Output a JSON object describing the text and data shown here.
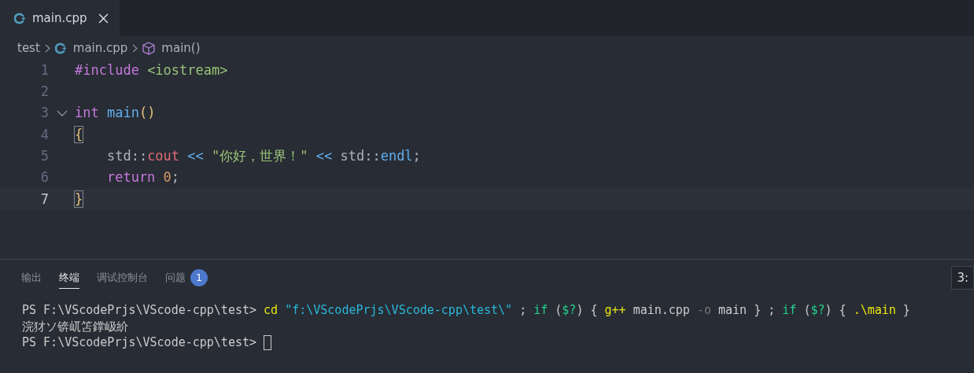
{
  "tabs": [
    {
      "label": "main.cpp",
      "selected": true
    }
  ],
  "breadcrumb": [
    {
      "kind": "folder",
      "label": "test"
    },
    {
      "kind": "file",
      "label": "main.cpp"
    },
    {
      "kind": "symbol",
      "label": "main()"
    }
  ],
  "code_lines": [
    {
      "number": "1",
      "current": false,
      "foldable": false,
      "tokens": [
        {
          "kind": "keyword",
          "text": "#include"
        },
        {
          "kind": "string",
          "text": " <iostream>"
        }
      ]
    },
    {
      "number": "2",
      "current": false,
      "foldable": false
    },
    {
      "number": "3",
      "current": false,
      "foldable": true,
      "tokens": [
        {
          "kind": "keyword",
          "text": "int"
        },
        {
          "kind": "function",
          "text": " main"
        },
        {
          "kind": "bracket",
          "text": "()"
        }
      ]
    },
    {
      "number": "4",
      "current": false,
      "foldable": false,
      "tokens": [
        {
          "kind": "bracket_matched",
          "text": "{"
        }
      ]
    },
    {
      "number": "5",
      "current": false,
      "foldable": false,
      "tokens": [
        {
          "kind": "plain",
          "text": "    std::"
        },
        {
          "kind": "member",
          "text": "cout"
        },
        {
          "kind": "operator",
          "text": " <<"
        },
        {
          "kind": "string",
          "text": " \"你好，世界！\""
        },
        {
          "kind": "operator",
          "text": " <<"
        },
        {
          "kind": "plain",
          "text": " std::"
        },
        {
          "kind": "function",
          "text": "endl"
        },
        {
          "kind": "plain",
          "text": ";"
        }
      ]
    },
    {
      "number": "6",
      "current": false,
      "foldable": false,
      "tokens": [
        {
          "kind": "keyword",
          "text": "    return"
        },
        {
          "kind": "number",
          "text": " 0"
        },
        {
          "kind": "plain",
          "text": ";"
        }
      ]
    },
    {
      "number": "7",
      "current": true,
      "foldable": false,
      "tokens": [
        {
          "kind": "bracket_matched",
          "text": "}"
        }
      ]
    }
  ],
  "panel_tabs": [
    {
      "label": "输出",
      "selected": false
    },
    {
      "label": "终端",
      "selected": true
    },
    {
      "label": "调试控制台",
      "selected": false
    },
    {
      "label": "问题",
      "selected": false,
      "badge": "1"
    }
  ],
  "terminal_selector": "3:",
  "terminal_lines": [
    {
      "tokens": [
        {
          "kind": "plain",
          "text": "PS F:\\VScodePrjs\\VScode-cpp\\test> "
        },
        {
          "kind": "command",
          "text": "cd"
        },
        {
          "kind": "string",
          "text": " \"f:\\VScodePrjs\\VScode-cpp\\test\\\""
        },
        {
          "kind": "plain",
          "text": " ; "
        },
        {
          "kind": "keyword",
          "text": "if"
        },
        {
          "kind": "plain",
          "text": " ("
        },
        {
          "kind": "keyword",
          "text": "$?"
        },
        {
          "kind": "plain",
          "text": ") { "
        },
        {
          "kind": "command",
          "text": "g++"
        },
        {
          "kind": "plain",
          "text": " main.cpp "
        },
        {
          "kind": "parameter",
          "text": "-o"
        },
        {
          "kind": "plain",
          "text": " main } ; "
        },
        {
          "kind": "keyword",
          "text": "if"
        },
        {
          "kind": "plain",
          "text": " ("
        },
        {
          "kind": "keyword",
          "text": "$?"
        },
        {
          "kind": "plain",
          "text": ") { "
        },
        {
          "kind": "command",
          "text": ".\\main"
        },
        {
          "kind": "plain",
          "text": " }"
        }
      ]
    },
    {
      "tokens": [
        {
          "kind": "plain",
          "text": "浣犲ソ锛屼笘鐣岋紒"
        }
      ]
    },
    {
      "tokens": [
        {
          "kind": "plain",
          "text": "PS F:\\VScodePrjs\\VScode-cpp\\test> "
        },
        {
          "kind": "cursor"
        }
      ]
    }
  ]
}
